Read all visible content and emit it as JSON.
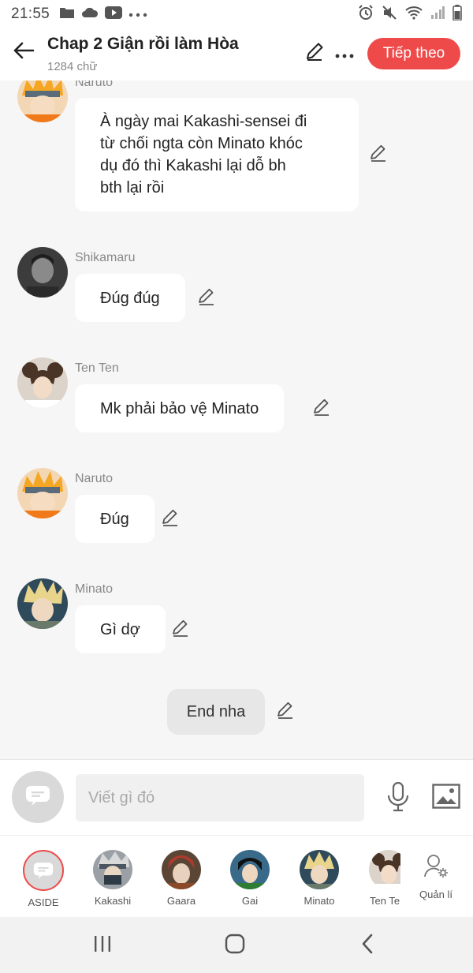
{
  "status_bar": {
    "time": "21:55",
    "left_icons": [
      "folder-icon",
      "cloud-icon",
      "youtube-icon",
      "more-dots-icon"
    ],
    "right_icons": [
      "alarm-icon",
      "mute-icon",
      "wifi-icon",
      "signal-icon",
      "battery-icon"
    ]
  },
  "header": {
    "title": "Chap 2 Giận rồi làm Hòa",
    "word_count": "1284 chữ",
    "next_label": "Tiếp theo",
    "accent_color": "#ef4a4a"
  },
  "messages": [
    {
      "speaker": "Naruto",
      "text_lines": [
        "À ngày mai Kakashi-sensei đi",
        "từ chối ngta còn Minato khóc",
        "dụ đó thì Kakashi lại dỗ bh",
        "bth lại rồi"
      ]
    },
    {
      "speaker": "Shikamaru",
      "text": "Đúg đúg"
    },
    {
      "speaker": "Ten Ten",
      "text": "Mk phải bảo vệ Minato"
    },
    {
      "speaker": "Naruto",
      "text": "Đúg"
    },
    {
      "speaker": "Minato",
      "text": "Gì dợ"
    }
  ],
  "end_message": "End nha",
  "composer": {
    "placeholder": "Viết gì đó"
  },
  "characters": [
    {
      "label": "ASIDE"
    },
    {
      "label": "Kakashi"
    },
    {
      "label": "Gaara"
    },
    {
      "label": "Gai"
    },
    {
      "label": "Minato"
    },
    {
      "label": "Ten Te"
    }
  ],
  "manage_label": "Quản lí",
  "nav": [
    "recent-apps-icon",
    "home-icon",
    "back-icon"
  ]
}
